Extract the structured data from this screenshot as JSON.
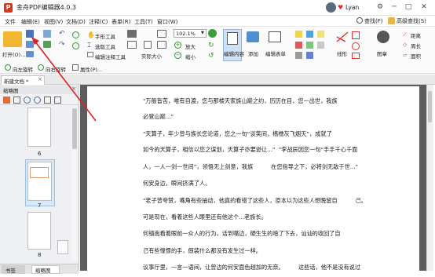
{
  "app": {
    "title": "金舟PDF编辑器4.0.3",
    "user_name": "Lyan"
  },
  "menu": {
    "items": [
      "文件",
      "编辑(E)",
      "视图(V)",
      "文档(D)",
      "注释(C)",
      "表单(R)",
      "工具(T)",
      "窗口(W)"
    ],
    "right": [
      "查找(F)",
      "高级查找(S)"
    ]
  },
  "ribbon": {
    "open_label": "打开(O)...",
    "hand_tool": "手形工具",
    "select_tool": "选取工具",
    "edit_annot_tool": "编辑注释工具",
    "actual_size": "实际大小",
    "zoom_value": "102.1%",
    "zoom_in": "放大",
    "zoom_out": "缩小",
    "edit_content": "编辑内容",
    "add": "添加",
    "edit_form": "编辑表单",
    "line_shape": "线形",
    "stamp": "图章",
    "rotate_left": "向左旋转",
    "rotate_right": "向右旋转",
    "properties": "属性(P)...",
    "shape_labels": [
      "距离",
      "周长",
      "面积"
    ]
  },
  "tabs": {
    "document": "新建文档 *"
  },
  "sidebar": {
    "header": "缩略图",
    "page_numbers": [
      "6",
      "7",
      "8"
    ],
    "bottom_tabs": [
      "书签",
      "缩略图"
    ]
  },
  "document": {
    "lines": [
      "\"万般皆苦，唯有自渡，您与那楼天家族山巅之约，历历在目，您一出世，我族",
      "必登山巅...\"",
      "\"天算子，年少曾与族长您论道，您之一句“谈笑间，樯橹灰飞烟灭”，成就了",
      "如今的天算子，相信以您之谋划，天算子亦要逊让...\"  \"李战辰因您一句“手手千心千面",
      "人，一人一剑一世间”，领悟无上剑意，我族          在您指导之下，必将剑无敌于世...\"",
      "何安身边，瞬间挤满了人。",
      "\"老子曾夸赞，嘴角有些抽动，他真的看错了这些人，原本以为这些人想晚留自          己。",
      "可是现在，看着这些人眼里还有他这个...老族长。",
      "何镇南看着眼前一众人的行为，话到嘴边，硬生生的噎了下去，讪讪的收回了自",
      "己有些憧憬的手，假装什么都没有发生过一样。",
      "议事厅里，一言一语间，让曾边的何安面色越加的无奈。        这些话，他不是没有说过"
    ]
  }
}
